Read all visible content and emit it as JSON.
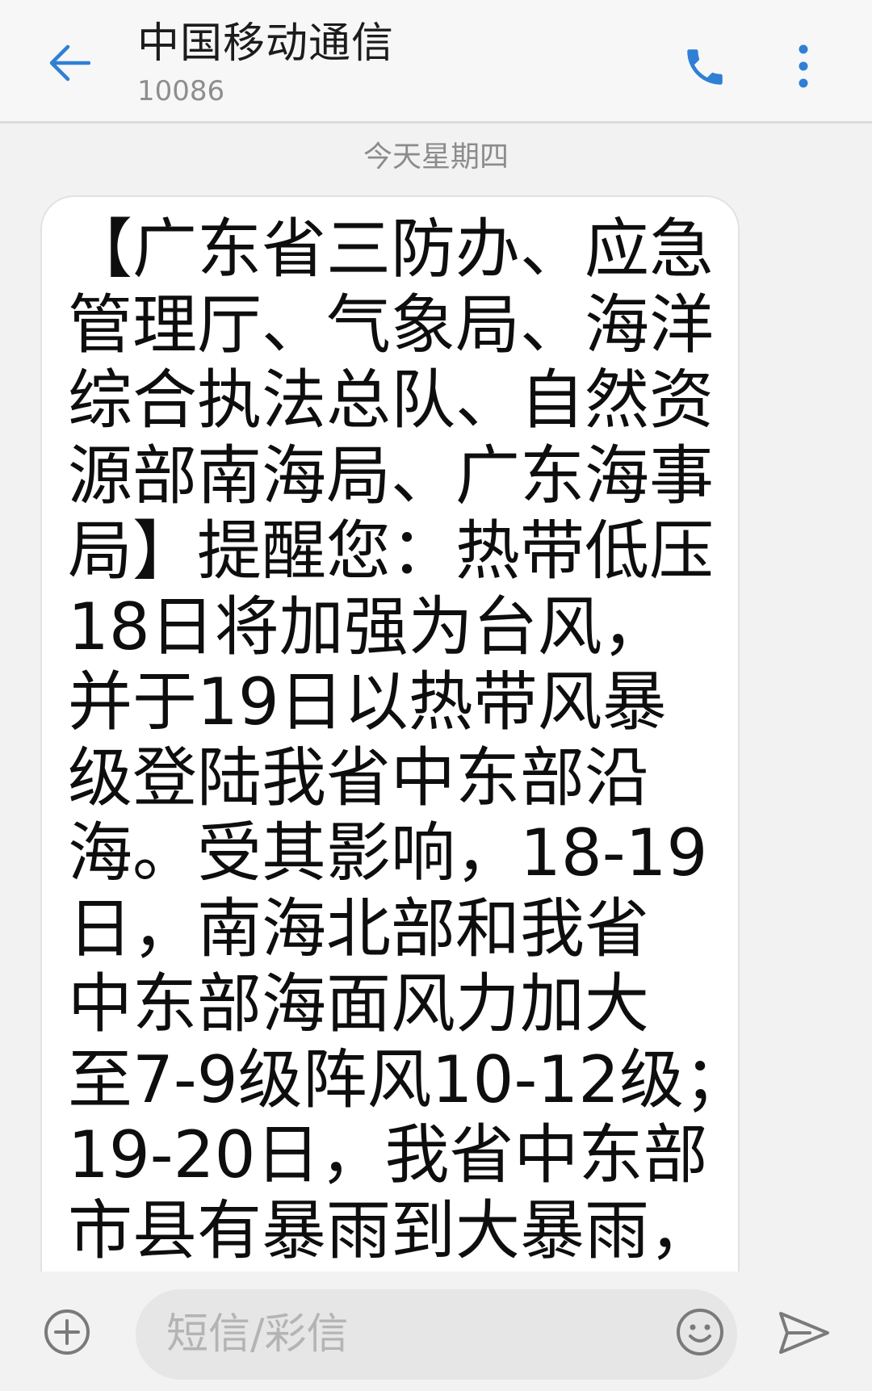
{
  "header": {
    "contact_name": "中国移动通信",
    "contact_number": "10086",
    "back_icon": "arrow-left-icon",
    "call_icon": "phone-icon",
    "more_icon": "more-vertical-icon"
  },
  "conversation": {
    "date_divider": "今天星期四",
    "messages": [
      {
        "direction": "incoming",
        "text": "【广东省三防办、应急\n管理厅、气象局、海洋\n综合执法总队、自然资\n源部南海局、广东海事\n局】提醒您：热带低压\n18日将加强为台风，\n并于19日以热带风暴\n级登陆我省中东部沿\n海。受其影响，18-19\n日，南海北部和我省\n中东部海面风力加大\n至7-9级阵风10-12级；\n19-20日，我省中东部\n市县有暴雨到大暴雨，"
      }
    ]
  },
  "composer": {
    "placeholder": "短信/彩信",
    "value": "",
    "add_icon": "plus-circle-icon",
    "emoji_icon": "smiley-icon",
    "send_icon": "send-icon"
  },
  "colors": {
    "accent_blue": "#2f7fd6",
    "icon_gray": "#7a7a7a",
    "background": "#f2f2f2",
    "bubble": "#ffffff"
  }
}
